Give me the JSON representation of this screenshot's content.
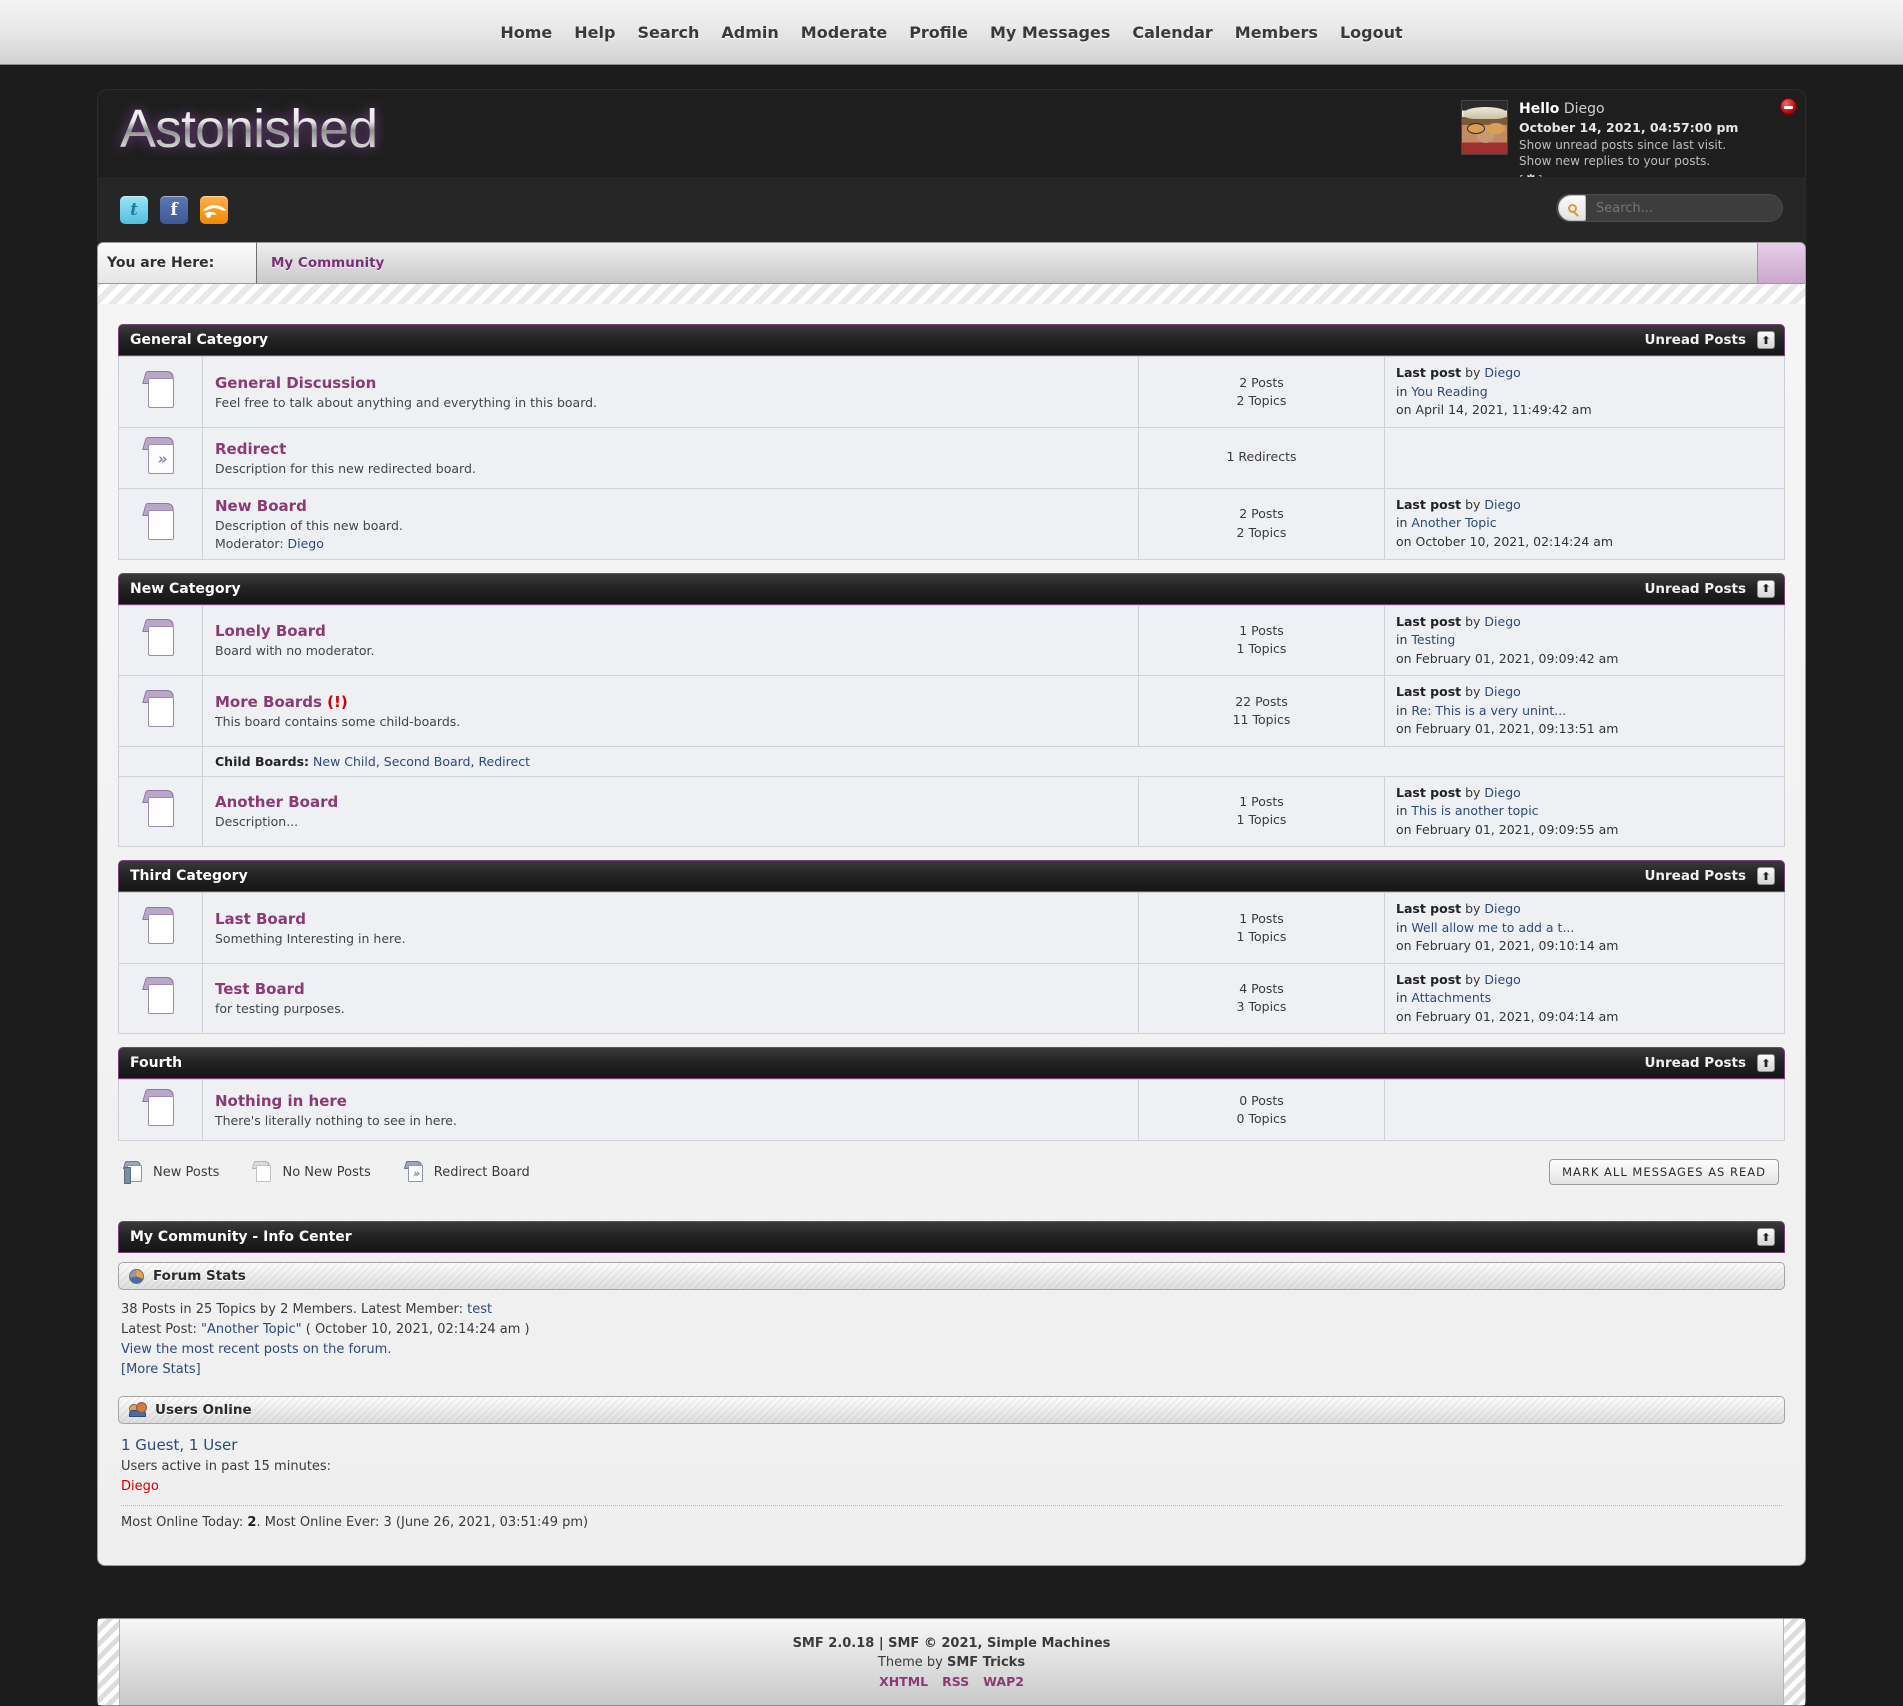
{
  "topnav": {
    "items": [
      {
        "label": "Home",
        "name": "nav-home"
      },
      {
        "label": "Help",
        "name": "nav-help"
      },
      {
        "label": "Search",
        "name": "nav-search"
      },
      {
        "label": "Admin",
        "name": "nav-admin"
      },
      {
        "label": "Moderate",
        "name": "nav-moderate"
      },
      {
        "label": "Profile",
        "name": "nav-profile"
      },
      {
        "label": "My Messages",
        "name": "nav-my-messages"
      },
      {
        "label": "Calendar",
        "name": "nav-calendar"
      },
      {
        "label": "Members",
        "name": "nav-members"
      },
      {
        "label": "Logout",
        "name": "nav-logout"
      }
    ]
  },
  "header": {
    "logo_text": "Astonished",
    "greeting_hello": "Hello",
    "greeting_user": "Diego",
    "datetime": "October 14, 2021, 04:57:00 pm",
    "link_unread": "Show unread posts since last visit.",
    "link_replies": "Show new replies to your posts.",
    "settings_glyph": "⚙",
    "logout_icon": "logout-icon"
  },
  "social": {
    "twitter": "t",
    "facebook": "f",
    "rss": "rss"
  },
  "search": {
    "placeholder": "Search...",
    "value": ""
  },
  "breadcrumb": {
    "label": "You are Here:",
    "path": "My Community"
  },
  "collapse_glyph": "⬆",
  "unread_label": "Unread Posts",
  "categories": [
    {
      "name": "General Category",
      "boards": [
        {
          "icon": "folder",
          "title": "General Discussion",
          "warn": "",
          "desc": "Feel free to talk about anything and everything in this board.",
          "moderator_label": "",
          "moderator": "",
          "posts": "2 Posts",
          "topics": "2 Topics",
          "last_prefix": "Last post",
          "last_by": "by",
          "last_author": "Diego",
          "last_in": "in",
          "last_topic": "You Reading",
          "last_on": "on April 14, 2021, 11:49:42 am",
          "children_label": "",
          "children": []
        },
        {
          "icon": "redirect",
          "title": "Redirect",
          "warn": "",
          "desc": "Description for this new redirected board.",
          "moderator_label": "",
          "moderator": "",
          "posts": "1 Redirects",
          "topics": "",
          "last_prefix": "",
          "last_by": "",
          "last_author": "",
          "last_in": "",
          "last_topic": "",
          "last_on": "",
          "children_label": "",
          "children": []
        },
        {
          "icon": "folder",
          "title": "New Board",
          "warn": "",
          "desc": "Description of this new board.",
          "moderator_label": "Moderator:",
          "moderator": "Diego",
          "posts": "2 Posts",
          "topics": "2 Topics",
          "last_prefix": "Last post",
          "last_by": "by",
          "last_author": "Diego",
          "last_in": "in",
          "last_topic": "Another Topic",
          "last_on": "on October 10, 2021, 02:14:24 am",
          "children_label": "",
          "children": []
        }
      ]
    },
    {
      "name": "New Category",
      "boards": [
        {
          "icon": "folder",
          "title": "Lonely Board",
          "warn": "",
          "desc": "Board with no moderator.",
          "moderator_label": "",
          "moderator": "",
          "posts": "1 Posts",
          "topics": "1 Topics",
          "last_prefix": "Last post",
          "last_by": "by",
          "last_author": "Diego",
          "last_in": "in",
          "last_topic": "Testing",
          "last_on": "on February 01, 2021, 09:09:42 am",
          "children_label": "",
          "children": []
        },
        {
          "icon": "folder",
          "title": "More Boards",
          "warn": "(!)",
          "desc": "This board contains some child-boards.",
          "moderator_label": "",
          "moderator": "",
          "posts": "22 Posts",
          "topics": "11 Topics",
          "last_prefix": "Last post",
          "last_by": "by",
          "last_author": "Diego",
          "last_in": "in",
          "last_topic": "Re: This is a very unint...",
          "last_on": "on February 01, 2021, 09:13:51 am",
          "children_label": "Child Boards:",
          "children": [
            "New Child",
            "Second Board",
            "Redirect"
          ]
        },
        {
          "icon": "folder",
          "title": "Another Board",
          "warn": "",
          "desc": "Description...",
          "moderator_label": "",
          "moderator": "",
          "posts": "1 Posts",
          "topics": "1 Topics",
          "last_prefix": "Last post",
          "last_by": "by",
          "last_author": "Diego",
          "last_in": "in",
          "last_topic": "This is another topic",
          "last_on": "on February 01, 2021, 09:09:55 am",
          "children_label": "",
          "children": []
        }
      ]
    },
    {
      "name": "Third Category",
      "boards": [
        {
          "icon": "folder",
          "title": "Last Board",
          "warn": "",
          "desc": "Something Interesting in here.",
          "moderator_label": "",
          "moderator": "",
          "posts": "1 Posts",
          "topics": "1 Topics",
          "last_prefix": "Last post",
          "last_by": "by",
          "last_author": "Diego",
          "last_in": "in",
          "last_topic": "Well allow me to add a t...",
          "last_on": "on February 01, 2021, 09:10:14 am",
          "children_label": "",
          "children": []
        },
        {
          "icon": "folder",
          "title": "Test Board",
          "warn": "",
          "desc": "for testing purposes.",
          "moderator_label": "",
          "moderator": "",
          "posts": "4 Posts",
          "topics": "3 Topics",
          "last_prefix": "Last post",
          "last_by": "by",
          "last_author": "Diego",
          "last_in": "in",
          "last_topic": "Attachments",
          "last_on": "on February 01, 2021, 09:04:14 am",
          "children_label": "",
          "children": []
        }
      ]
    },
    {
      "name": "Fourth",
      "boards": [
        {
          "icon": "folder",
          "title": "Nothing in here",
          "warn": "",
          "desc": "There's literally nothing to see in here.",
          "moderator_label": "",
          "moderator": "",
          "posts": "0 Posts",
          "topics": "0 Topics",
          "last_prefix": "",
          "last_by": "",
          "last_author": "",
          "last_in": "",
          "last_topic": "",
          "last_on": "",
          "children_label": "",
          "children": []
        }
      ]
    }
  ],
  "legend": {
    "new_posts": "New Posts",
    "no_new_posts": "No New Posts",
    "redirect_board": "Redirect Board",
    "mark_all_read": "MARK ALL MESSAGES AS READ"
  },
  "infocenter": {
    "title": "My Community - Info Center",
    "forum_stats": {
      "heading": "Forum Stats",
      "line1_a": "38 Posts in 25 Topics by 2 Members. Latest Member:",
      "line1_member": "test",
      "line2_a": "Latest Post:",
      "line2_topic": "\"Another Topic\"",
      "line2_b": "( October 10, 2021, 02:14:24 am )",
      "line3": "View the most recent posts on the forum.",
      "line4": "[More Stats]"
    },
    "users_online": {
      "heading": "Users Online",
      "count": "1 Guest, 1 User",
      "active_label": "Users active in past 15 minutes:",
      "users": "Diego",
      "most_online_a": "Most Online Today:",
      "most_online_today": "2",
      "most_online_b": ". Most Online Ever: 3 (June 26, 2021, 03:51:49 pm)"
    }
  },
  "footer": {
    "line1": "SMF 2.0.18 | SMF © 2021, Simple Machines",
    "line2_a": "Theme by",
    "line2_b": "SMF Tricks",
    "links": [
      "XHTML",
      "RSS",
      "WAP2"
    ]
  },
  "colors": {
    "accent_purple": "#8b3a73",
    "cat_border": "#7a3f7a",
    "link_blue": "#2c4a7c",
    "user_red": "#d00000",
    "warn_red": "#cc0000"
  }
}
